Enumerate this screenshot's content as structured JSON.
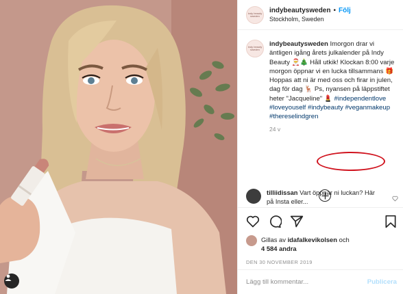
{
  "post": {
    "username": "indybeautysweden",
    "follow_label": "Följ",
    "location": "Stockholm, Sweden",
    "avatar_logo": "indy beauty sweden"
  },
  "caption": {
    "username": "indybeautysweden",
    "text_1": "Imorgon drar vi äntligen igång årets julkalender på Indy Beauty",
    "emoji_1": "🎅",
    "emoji_2": "🎄",
    "text_2": "Håll utkik! Klockan 8:00 varje morgon öppnar vi en lucka tillsammans",
    "emoji_3": "🎁",
    "text_3": "Hoppas att ni är med oss och firar in julen, dag för dag",
    "emoji_4": "🦌",
    "text_4": "Ps, nyansen på läppstiftet heter \"Jacqueline\"",
    "emoji_5": "💄",
    "hashtags": [
      "#independentlove",
      "#loveyouself",
      "#indybeauty",
      "#veganmakeup",
      "#thereselindgren"
    ],
    "time_ago": "24 v"
  },
  "comment": {
    "username": "tilliidissan",
    "text": "Vart öppnar ni luckan? Här på Insta eller..."
  },
  "likes": {
    "prefix": "Gillas av",
    "user": "idafalkevikolsen",
    "joiner": "och",
    "count": "4 584 andra"
  },
  "date": "DEN 30 NOVEMBER 2019",
  "add_comment": {
    "placeholder": "Lägg till kommentar...",
    "publish_label": "Publicera"
  },
  "icons": [
    "heart-icon",
    "comment-icon",
    "share-icon",
    "bookmark-icon",
    "plus-circle-icon",
    "user-icon"
  ],
  "colors": {
    "link": "#00376b",
    "follow": "#0095f6",
    "highlight_circle": "#d0131e",
    "publish": "#b2dffc"
  }
}
